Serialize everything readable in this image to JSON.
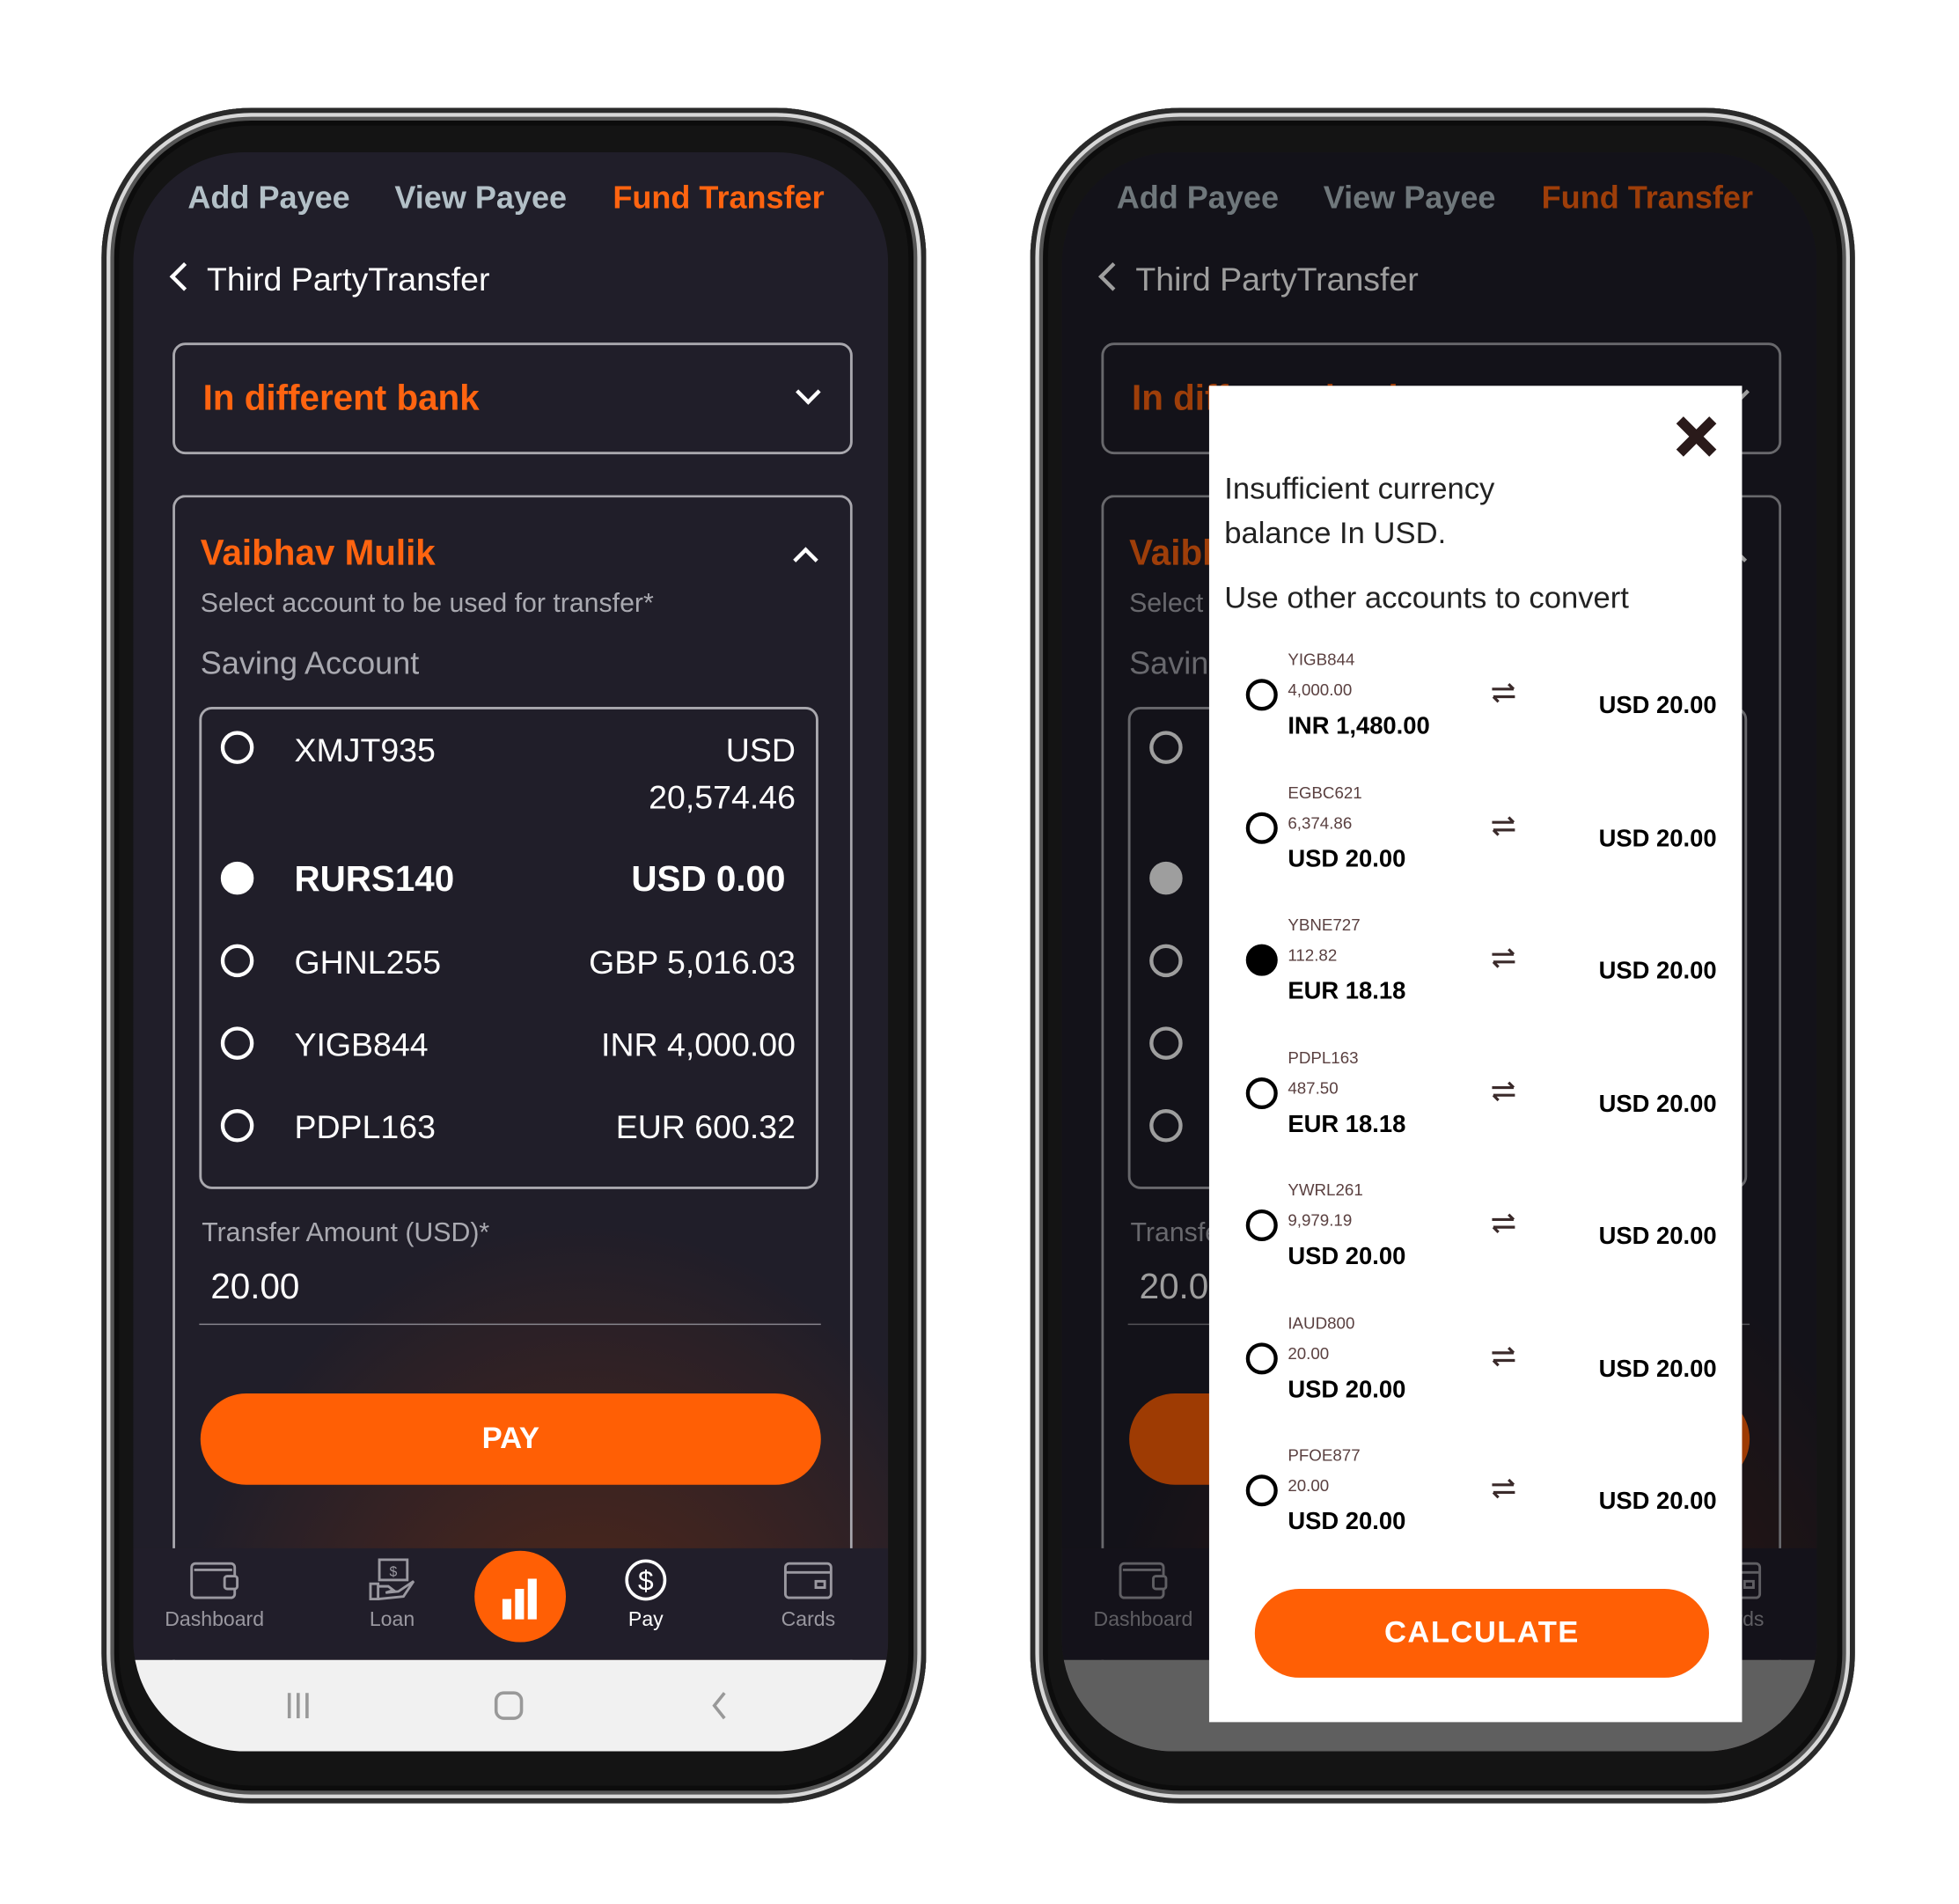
{
  "header": {
    "tabs": [
      {
        "label": "Add Payee"
      },
      {
        "label": "View Payee"
      },
      {
        "label": "Fund Transfer",
        "active": true
      }
    ]
  },
  "back_title": "Third PartyTransfer",
  "transfer_type": "In different bank",
  "payee": {
    "name": "Vaibhav Mulik",
    "instruction": "Select account to be used for transfer*",
    "account_type": "Saving Account",
    "accounts": [
      {
        "id": "XMJT935",
        "currency": "USD",
        "amount": "20,574.46",
        "selected": false
      },
      {
        "id": "RURS140",
        "balance": "USD 0.00",
        "selected": true
      },
      {
        "id": "GHNL255",
        "balance": "GBP 5,016.03",
        "selected": false
      },
      {
        "id": "YIGB844",
        "balance": "INR 4,000.00",
        "selected": false
      },
      {
        "id": "PDPL163",
        "balance": "EUR 600.32",
        "selected": false
      }
    ]
  },
  "amount": {
    "label": "Transfer Amount (USD)*",
    "value": "20.00"
  },
  "pay_label": "PAY",
  "bottom_nav": [
    {
      "label": "Dashboard",
      "icon": "wallet-icon"
    },
    {
      "label": "Loan",
      "icon": "loan-hand-icon"
    },
    {
      "label": "",
      "icon": "bar-chart-icon"
    },
    {
      "label": "Pay",
      "icon": "dollar-circle-icon",
      "active": true
    },
    {
      "label": "Cards",
      "icon": "card-icon"
    }
  ],
  "modal": {
    "message_line1": "Insufficient currency",
    "message_line2": "balance In USD.",
    "prompt": "Use other accounts to convert",
    "calculate_label": "CALCULATE",
    "rows": [
      {
        "id": "YIGB844",
        "balance": "4,000.00",
        "converted": "INR 1,480.00",
        "target": "USD 20.00",
        "selected": false
      },
      {
        "id": "EGBC621",
        "balance": "6,374.86",
        "converted": "USD 20.00",
        "target": "USD 20.00",
        "selected": false
      },
      {
        "id": "YBNE727",
        "balance": "112.82",
        "converted": "EUR 18.18",
        "target": "USD 20.00",
        "selected": true
      },
      {
        "id": "PDPL163",
        "balance": "487.50",
        "converted": "EUR 18.18",
        "target": "USD 20.00",
        "selected": false
      },
      {
        "id": "YWRL261",
        "balance": "9,979.19",
        "converted": "USD 20.00",
        "target": "USD 20.00",
        "selected": false
      },
      {
        "id": "IAUD800",
        "balance": "20.00",
        "converted": "USD 20.00",
        "target": "USD 20.00",
        "selected": false
      },
      {
        "id": "PFOE877",
        "balance": "20.00",
        "converted": "USD 20.00",
        "target": "USD 20.00",
        "selected": false
      }
    ]
  },
  "colors": {
    "accent": "#ff5f05",
    "background": "#201e29",
    "tab_inactive": "#b3c0c7"
  }
}
